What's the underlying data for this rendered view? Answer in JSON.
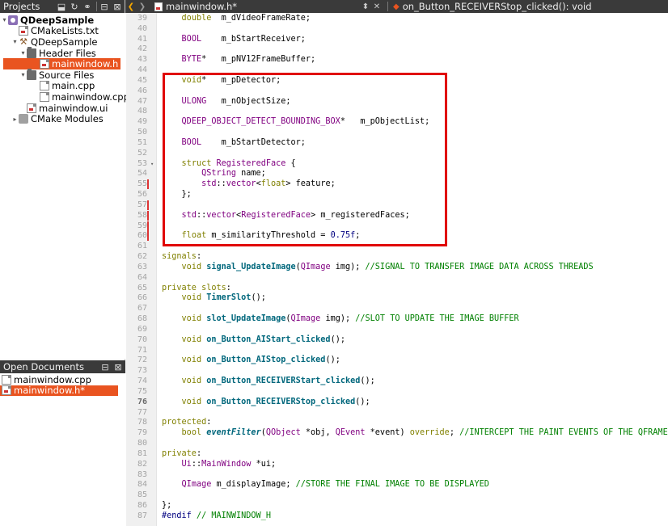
{
  "sidebar": {
    "projects_title": "Projects",
    "open_docs_title": "Open Documents",
    "tree": [
      {
        "label": "QDeepSample",
        "icon": "project-icon",
        "arrow": "▾",
        "bold": true
      },
      {
        "label": "CMakeLists.txt",
        "icon": "cmake-file-icon",
        "arrow": ""
      },
      {
        "label": "QDeepSample",
        "icon": "hammer-icon",
        "arrow": "▾"
      },
      {
        "label": "Header Files",
        "icon": "folder-icon",
        "arrow": "▾"
      },
      {
        "label": "mainwindow.h",
        "icon": "header-file-icon",
        "arrow": "",
        "selected": true
      },
      {
        "label": "Source Files",
        "icon": "folder-icon",
        "arrow": "▾"
      },
      {
        "label": "main.cpp",
        "icon": "cpp-file-icon",
        "arrow": ""
      },
      {
        "label": "mainwindow.cpp",
        "icon": "cpp-file-icon",
        "arrow": ""
      },
      {
        "label": "mainwindow.ui",
        "icon": "ui-file-icon",
        "arrow": ""
      },
      {
        "label": "CMake Modules",
        "icon": "cmake-folder-icon",
        "arrow": "▸"
      }
    ],
    "open_documents": [
      {
        "label": "mainwindow.cpp",
        "selected": false
      },
      {
        "label": "mainwindow.h*",
        "selected": true
      }
    ]
  },
  "toolbar": {
    "filename": "mainwindow.h*",
    "symbol": "on_Button_RECEIVERStop_clicked(): void"
  },
  "editor": {
    "current_line": "76",
    "lines": [
      {
        "n": "39",
        "html": "    <span class=\"kw\">double</span>  m_dVideoFrameRate;"
      },
      {
        "n": "40",
        "html": ""
      },
      {
        "n": "41",
        "html": "    <span class=\"ty\">BOOL</span>    m_bStartReceiver;"
      },
      {
        "n": "42",
        "html": ""
      },
      {
        "n": "43",
        "html": "    <span class=\"ty\">BYTE</span>*   m_pNV12FrameBuffer;"
      },
      {
        "n": "44",
        "html": ""
      },
      {
        "n": "45",
        "html": "    <span class=\"kw\">void</span>*   m_pDetector;"
      },
      {
        "n": "46",
        "html": ""
      },
      {
        "n": "47",
        "html": "    <span class=\"ty\">ULONG</span>   m_nObjectSize;"
      },
      {
        "n": "48",
        "html": ""
      },
      {
        "n": "49",
        "html": "    <span class=\"ty\">QDEEP_OBJECT_DETECT_BOUNDING_BOX</span>*   m_pObjectList;"
      },
      {
        "n": "50",
        "html": ""
      },
      {
        "n": "51",
        "html": "    <span class=\"ty\">BOOL</span>    m_bStartDetector;"
      },
      {
        "n": "52",
        "html": ""
      },
      {
        "n": "53",
        "html": "    <span class=\"kw\">struct</span> <span class=\"ty\">RegisteredFace</span> {",
        "fold": true
      },
      {
        "n": "54",
        "html": "        <span class=\"ty\">QString</span> name;"
      },
      {
        "n": "55",
        "html": "        <span class=\"ty\">std</span>::<span class=\"ty\">vector</span>&lt;<span class=\"kw\">float</span>&gt; feature;",
        "modified": true
      },
      {
        "n": "56",
        "html": "    };"
      },
      {
        "n": "57",
        "html": "",
        "modified": true
      },
      {
        "n": "58",
        "html": "    <span class=\"ty\">std</span>::<span class=\"ty\">vector</span>&lt;<span class=\"ty\">RegisteredFace</span>&gt; m_registeredFaces;",
        "modified": true
      },
      {
        "n": "59",
        "html": "",
        "modified": true
      },
      {
        "n": "60",
        "html": "    <span class=\"kw\">float</span> m_similarityThreshold = <span class=\"nm\">0.75f</span>;",
        "modified": true
      },
      {
        "n": "61",
        "html": ""
      },
      {
        "n": "62",
        "html": "<span class=\"kw\">signals</span>:"
      },
      {
        "n": "63",
        "html": "    <span class=\"kw\">void</span> <span class=\"fn\">signal_UpdateImage</span>(<span class=\"ty\">QImage</span> img); <span class=\"cm\">//SIGNAL TO TRANSFER IMAGE DATA ACROSS THREADS</span>"
      },
      {
        "n": "64",
        "html": ""
      },
      {
        "n": "65",
        "html": "<span class=\"kw\">private</span> <span class=\"kw\">slots</span>:"
      },
      {
        "n": "66",
        "html": "    <span class=\"kw\">void</span> <span class=\"fn\">TimerSlot</span>();"
      },
      {
        "n": "67",
        "html": ""
      },
      {
        "n": "68",
        "html": "    <span class=\"kw\">void</span> <span class=\"fn\">slot_UpdateImage</span>(<span class=\"ty\">QImage</span> img); <span class=\"cm\">//SLOT TO UPDATE THE IMAGE BUFFER</span>"
      },
      {
        "n": "69",
        "html": ""
      },
      {
        "n": "70",
        "html": "    <span class=\"kw\">void</span> <span class=\"fn\">on_Button_AIStart_clicked</span>();"
      },
      {
        "n": "71",
        "html": ""
      },
      {
        "n": "72",
        "html": "    <span class=\"kw\">void</span> <span class=\"fn\">on_Button_AIStop_clicked</span>();"
      },
      {
        "n": "73",
        "html": ""
      },
      {
        "n": "74",
        "html": "    <span class=\"kw\">void</span> <span class=\"fn\">on_Button_RECEIVERStart_clicked</span>();"
      },
      {
        "n": "75",
        "html": ""
      },
      {
        "n": "76",
        "html": "    <span class=\"kw\">void</span> <span class=\"fn\">on_Button_RECEIVERStop_clicked</span>();"
      },
      {
        "n": "77",
        "html": ""
      },
      {
        "n": "78",
        "html": "<span class=\"kw\">protected</span>:"
      },
      {
        "n": "79",
        "html": "    <span class=\"kw\">bool</span> <span class=\"fn it\">eventFilter</span>(<span class=\"ty\">QObject</span> *obj, <span class=\"ty\">QEvent</span> *event) <span class=\"kw\">override</span>; <span class=\"cm\">//INTERCEPT THE PAINT EVENTS OF THE QFRAME</span>"
      },
      {
        "n": "80",
        "html": ""
      },
      {
        "n": "81",
        "html": "<span class=\"kw\">private</span>:"
      },
      {
        "n": "82",
        "html": "    <span class=\"ty\">Ui</span>::<span class=\"ty\">MainWindow</span> *ui;"
      },
      {
        "n": "83",
        "html": ""
      },
      {
        "n": "84",
        "html": "    <span class=\"ty\">QImage</span> m_displayImage; <span class=\"cm\">//STORE THE FINAL IMAGE TO BE DISPLAYED</span>"
      },
      {
        "n": "85",
        "html": ""
      },
      {
        "n": "86",
        "html": "};"
      },
      {
        "n": "87",
        "html": "<span class=\"mc\">#endif</span> <span class=\"cm\">// MAINWINDOW_H</span>"
      }
    ]
  },
  "colors": {
    "accent": "#e95420",
    "highlight_box": "#e00000",
    "modified_marker": "#dd3333"
  }
}
